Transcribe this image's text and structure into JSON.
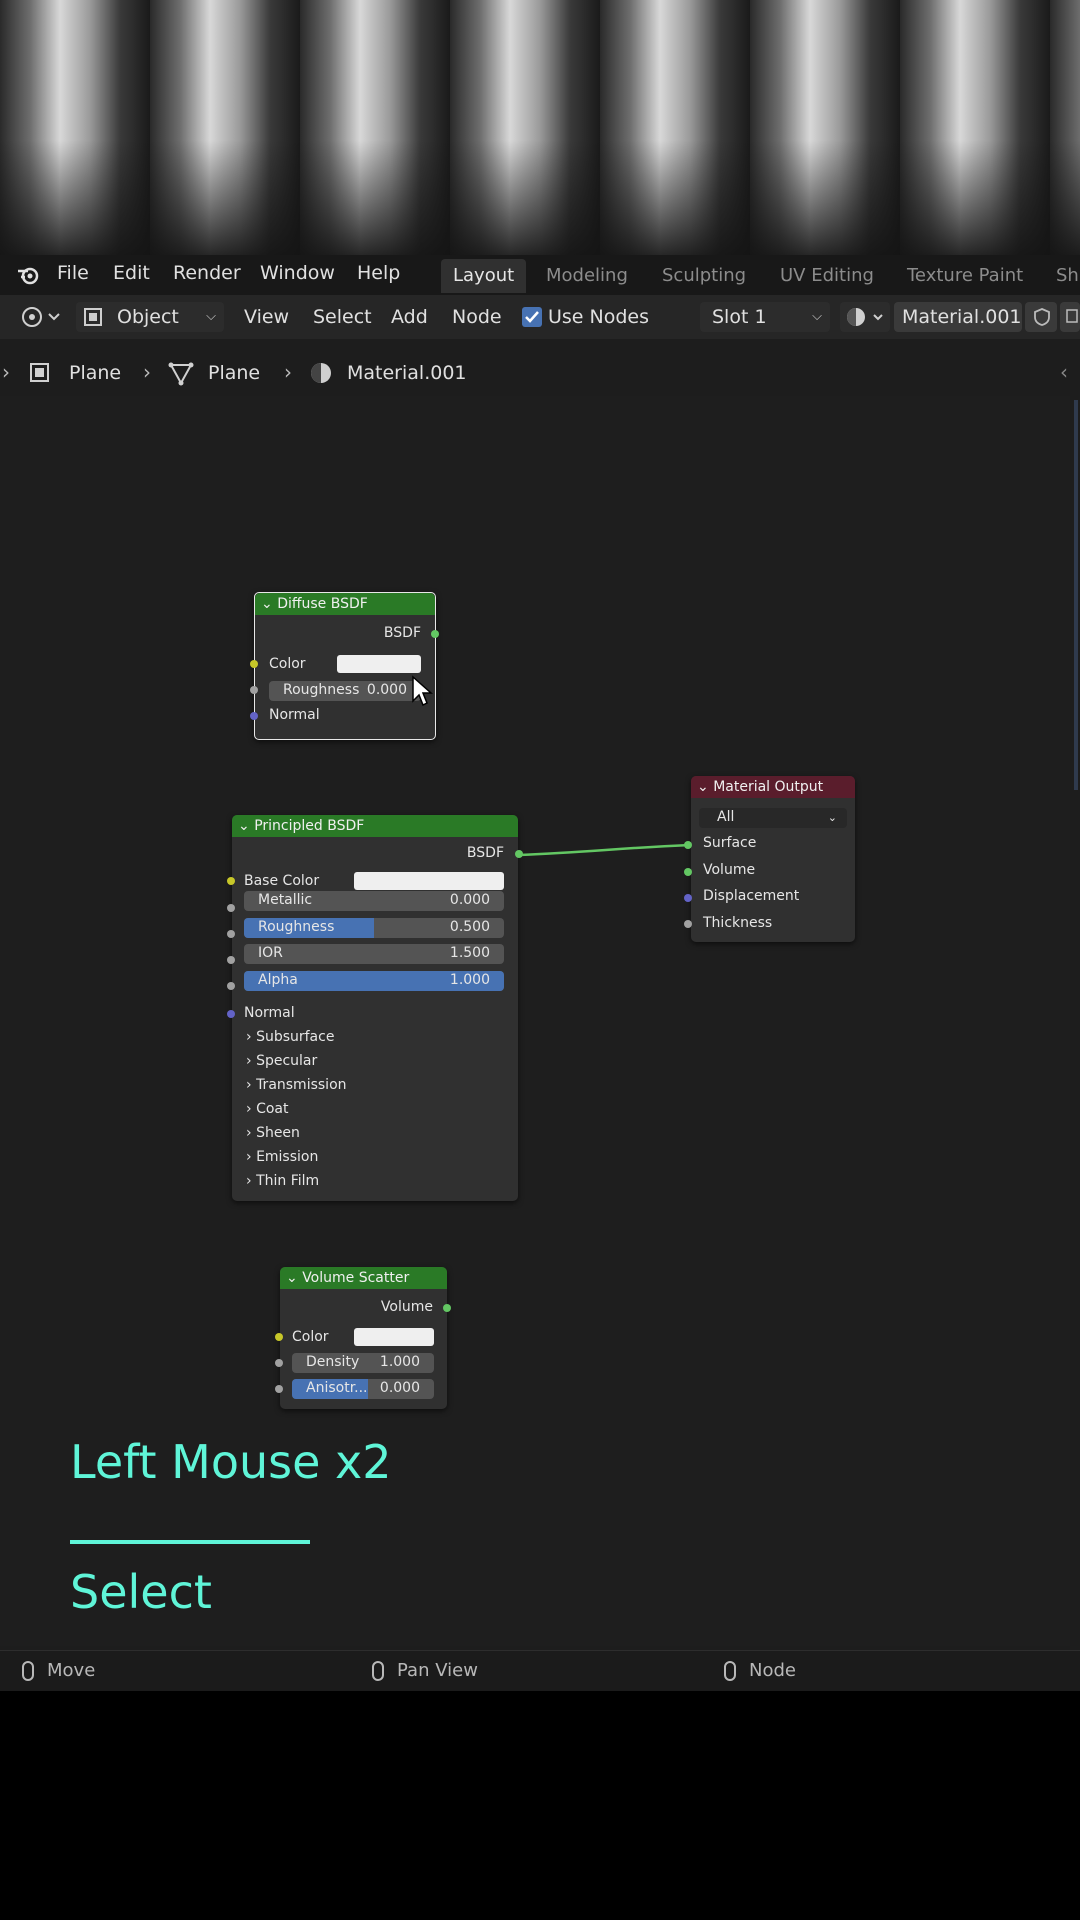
{
  "menubar": {
    "items": [
      "File",
      "Edit",
      "Render",
      "Window",
      "Help"
    ],
    "workspaces": [
      "Layout",
      "Modeling",
      "Sculpting",
      "UV Editing",
      "Texture Paint",
      "Sh"
    ],
    "active_workspace": "Layout"
  },
  "header": {
    "mode": "Object",
    "menus": [
      "View",
      "Select",
      "Add",
      "Node"
    ],
    "use_nodes_label": "Use Nodes",
    "use_nodes_checked": true,
    "slot": "Slot 1",
    "material": "Material.001"
  },
  "breadcrumb": {
    "object": "Plane",
    "mesh": "Plane",
    "material": "Material.001"
  },
  "nodes": {
    "diffuse": {
      "title": "Diffuse BSDF",
      "output": "BSDF",
      "color_label": "Color",
      "roughness_label": "Roughness",
      "roughness_value": "0.000",
      "normal_label": "Normal"
    },
    "principled": {
      "title": "Principled BSDF",
      "output": "BSDF",
      "base_color_label": "Base Color",
      "fields": [
        {
          "label": "Metallic",
          "value": "0.000",
          "fill": 0
        },
        {
          "label": "Roughness",
          "value": "0.500",
          "fill": 0.5
        },
        {
          "label": "IOR",
          "value": "1.500",
          "fill": 0
        },
        {
          "label": "Alpha",
          "value": "1.000",
          "fill": 1
        }
      ],
      "normal_label": "Normal",
      "panels": [
        "Subsurface",
        "Specular",
        "Transmission",
        "Coat",
        "Sheen",
        "Emission",
        "Thin Film"
      ]
    },
    "output": {
      "title": "Material Output",
      "target": "All",
      "inputs": [
        "Surface",
        "Volume",
        "Displacement",
        "Thickness"
      ]
    },
    "volume": {
      "title": "Volume Scatter",
      "output": "Volume",
      "color_label": "Color",
      "density_label": "Density",
      "density_value": "1.000",
      "anisotropy_label": "Anisotr...",
      "anisotropy_value": "0.000"
    }
  },
  "overlay": {
    "key": "Left Mouse x2",
    "action": "Select",
    "color": "#5ff5d8"
  },
  "statusbar": {
    "items": [
      "Move",
      "Pan View",
      "Node"
    ]
  }
}
